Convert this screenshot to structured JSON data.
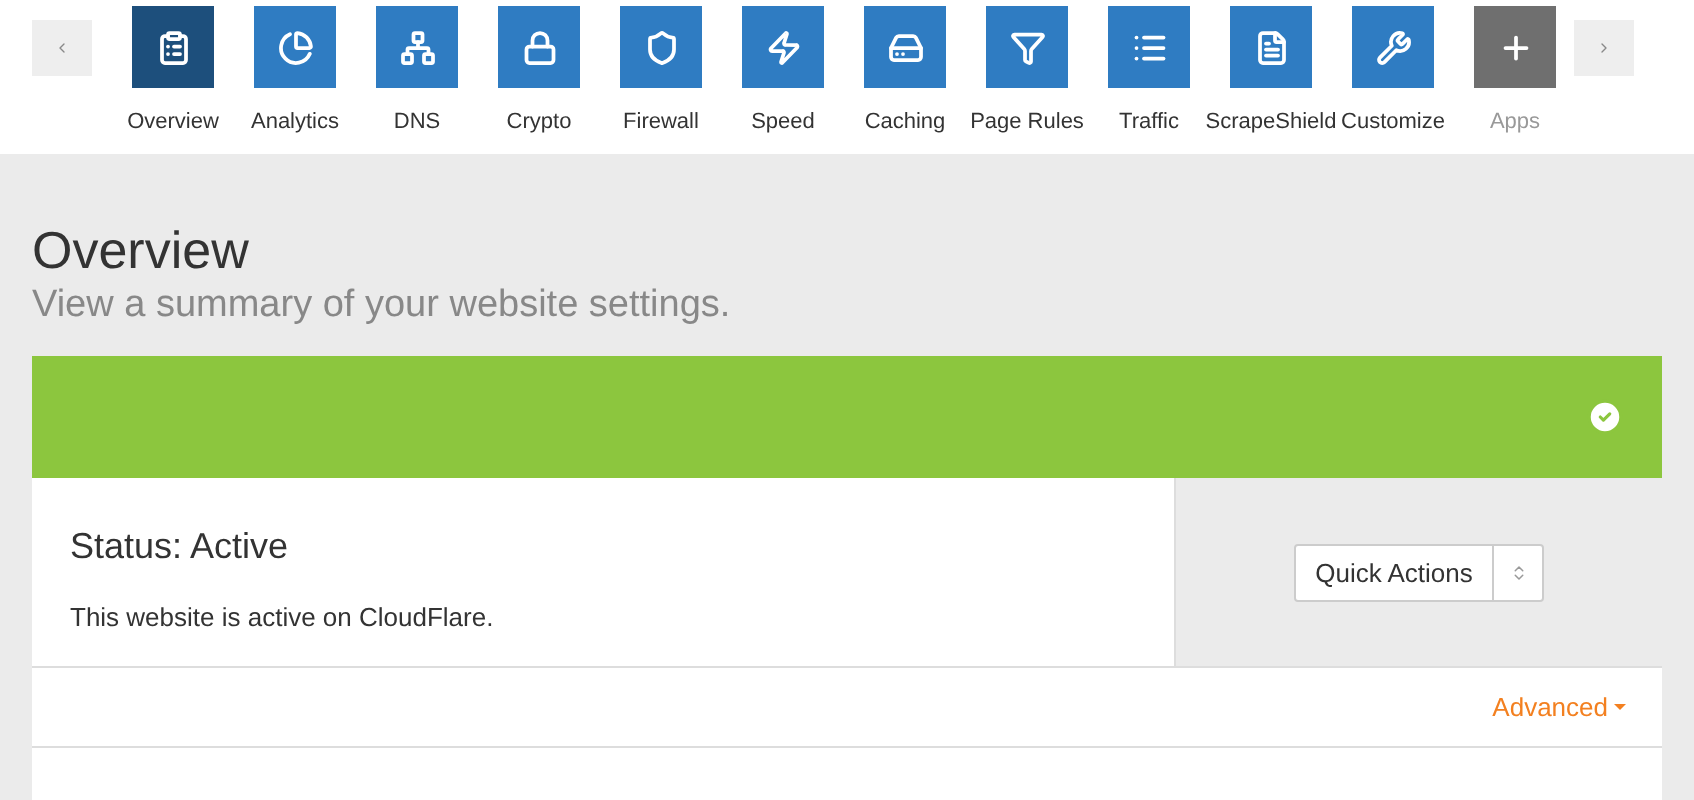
{
  "nav": {
    "tabs": [
      {
        "label": "Overview",
        "kind": "section",
        "selected": true
      },
      {
        "label": "Analytics",
        "kind": "section",
        "selected": false
      },
      {
        "label": "DNS",
        "kind": "section",
        "selected": false
      },
      {
        "label": "Crypto",
        "kind": "section",
        "selected": false
      },
      {
        "label": "Firewall",
        "kind": "section",
        "selected": false
      },
      {
        "label": "Speed",
        "kind": "section",
        "selected": false
      },
      {
        "label": "Caching",
        "kind": "section",
        "selected": false
      },
      {
        "label": "Page Rules",
        "kind": "section",
        "selected": false
      },
      {
        "label": "Traffic",
        "kind": "section",
        "selected": false
      },
      {
        "label": "ScrapeShield",
        "kind": "section",
        "selected": false
      },
      {
        "label": "Customize",
        "kind": "section",
        "selected": false
      },
      {
        "label": "Apps",
        "kind": "extra",
        "selected": false
      }
    ]
  },
  "page": {
    "title": "Overview",
    "subtitle": "View a summary of your website settings."
  },
  "status": {
    "title": "Status: Active",
    "text": "This website is active on CloudFlare.",
    "quick_actions": "Quick Actions",
    "advanced": "Advanced"
  }
}
